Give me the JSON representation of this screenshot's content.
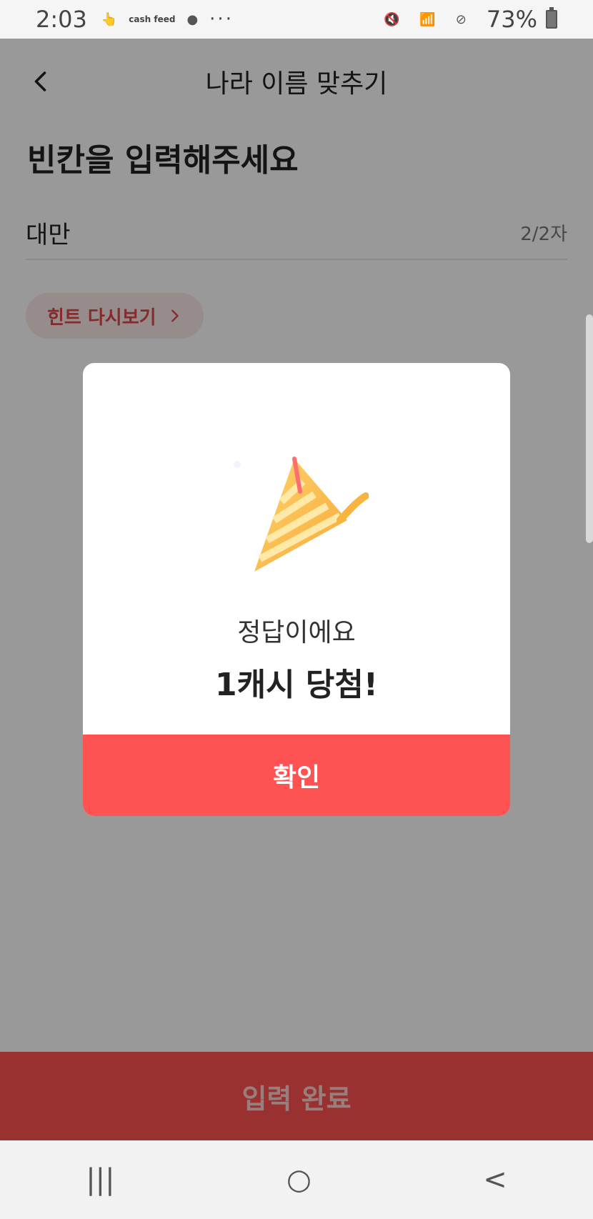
{
  "status_bar": {
    "time": "2:03",
    "app_icon_1": "hand-icon",
    "app_icon_2": "cash\nfeed",
    "app_icon_3": "c-icon",
    "more": "···",
    "battery": "73%"
  },
  "header": {
    "title": "나라 이름 맞추기",
    "back_icon": "back-chevron-icon"
  },
  "quiz": {
    "instruction": "빈칸을 입력해주세요",
    "answer_value": "대만",
    "char_count": "2/2자",
    "hint_label": "힌트 다시보기"
  },
  "modal": {
    "text": "정답이에요",
    "title": "1캐시 당첨!",
    "confirm_label": "확인"
  },
  "submit": {
    "label": "입력 완료"
  },
  "nav": {
    "recent": "|||",
    "home": "○",
    "back": "<"
  },
  "colors": {
    "accent": "#ff5252",
    "dim": "rgba(0,0,0,0.40)"
  }
}
